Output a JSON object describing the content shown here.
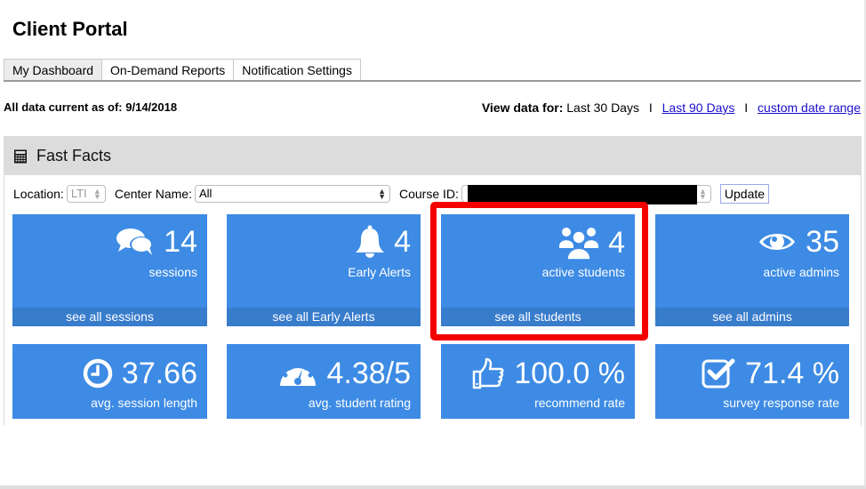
{
  "header": {
    "title": "Client Portal"
  },
  "tabs": [
    {
      "label": "My Dashboard",
      "active": true
    },
    {
      "label": "On-Demand Reports",
      "active": false
    },
    {
      "label": "Notification Settings",
      "active": false
    }
  ],
  "status": {
    "data_current_label": "All data current as of: 9/14/2018",
    "view_data_label": "View data for:",
    "current_range": "Last 30 Days",
    "separator": "I",
    "links": [
      "Last 90 Days",
      "custom date range"
    ]
  },
  "panel": {
    "title": "Fast Facts",
    "icon": "calculator-icon",
    "filters": {
      "location_label": "Location:",
      "location_value": "LTI",
      "center_label": "Center Name:",
      "center_value": "All",
      "course_label": "Course ID:",
      "course_value": "[redacted]",
      "update_label": "Update"
    }
  },
  "cards": [
    {
      "icon": "comments-icon",
      "value": "14",
      "label": "sessions",
      "footer": "see all sessions"
    },
    {
      "icon": "bell-icon",
      "value": "4",
      "label": "Early Alerts",
      "footer": "see all Early Alerts"
    },
    {
      "icon": "users-icon",
      "value": "4",
      "label": "active students",
      "footer": "see all students",
      "highlighted": true
    },
    {
      "icon": "eye-icon",
      "value": "35",
      "label": "active admins",
      "footer": "see all admins"
    },
    {
      "icon": "clock-icon",
      "value": "37.66",
      "label": "avg. session length"
    },
    {
      "icon": "dashboard-icon",
      "value": "4.38/5",
      "label": "avg. student rating"
    },
    {
      "icon": "thumbs-up-icon",
      "value": "100.0 %",
      "label": "recommend rate"
    },
    {
      "icon": "check-square-icon",
      "value": "71.4 %",
      "label": "survey response rate"
    }
  ],
  "colors": {
    "card_bg": "#3d8be4",
    "card_footer": "#387ccc",
    "highlight": "#f50000",
    "panel_header": "#dcdcdc",
    "link": "#1a0dcc"
  }
}
